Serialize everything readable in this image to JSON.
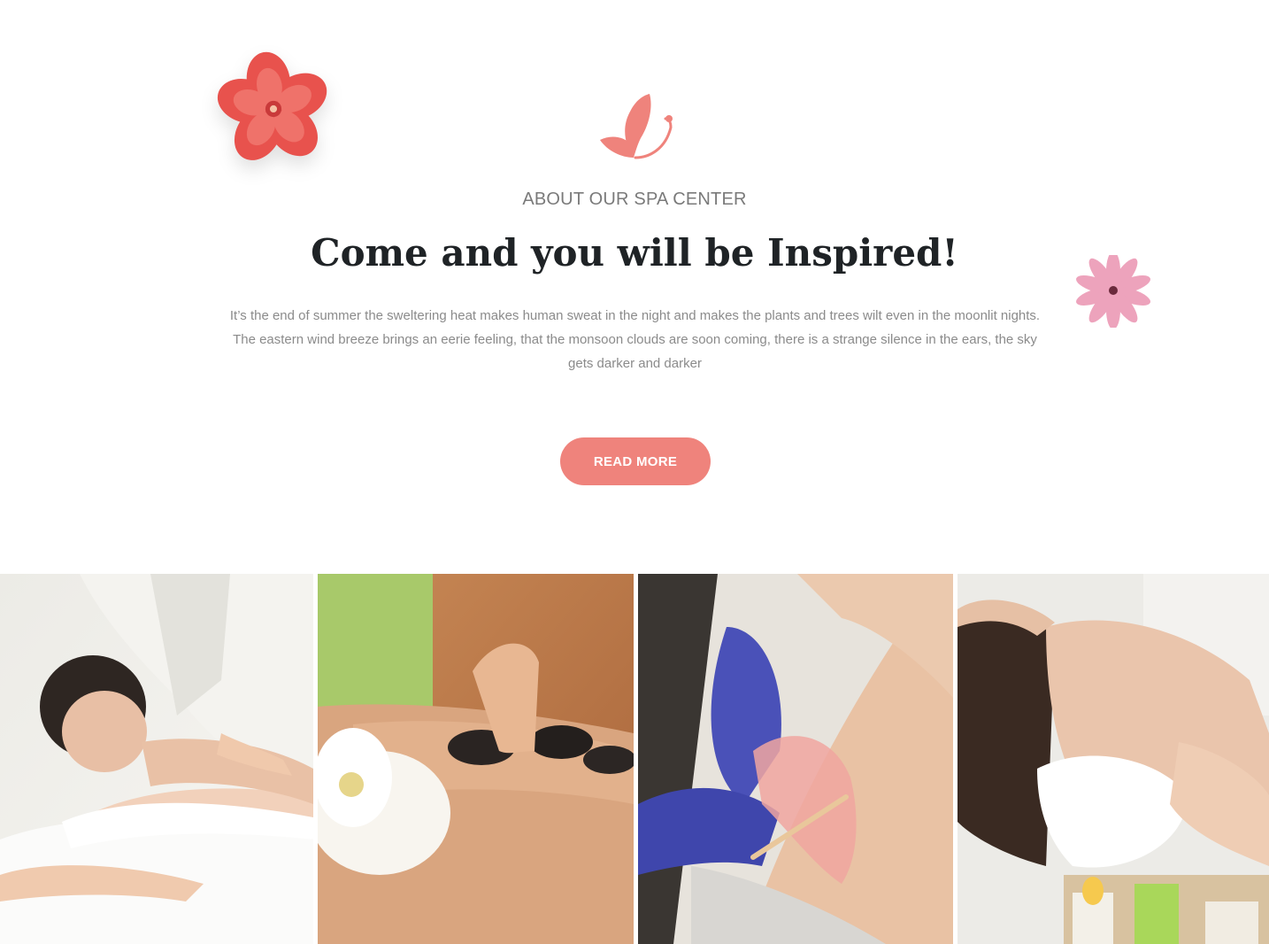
{
  "about": {
    "subtitle": "ABOUT OUR SPA CENTER",
    "title": "Come and you will be Inspired!",
    "body": "It’s the end of summer the sweltering heat makes human sweat in the night and makes the plants and trees wilt even in the moonlit nights. The eastern wind breeze brings an eerie feeling, that the monsoon clouds are soon coming, there is a strange silence in the ears, the sky gets darker and darker",
    "button_label": "READ MORE"
  },
  "colors": {
    "accent": "#ef837c",
    "title": "#1f2326",
    "text": "#8b8b8b"
  },
  "icons": {
    "decor_left": "red-hibiscus-flower-icon",
    "logo": "butterfly-icon",
    "decor_right": "pink-flower-icon"
  },
  "gallery": {
    "images": [
      "back-massage-photo",
      "hot-stone-massage-photo",
      "waxing-treatment-photo",
      "head-massage-photo"
    ]
  }
}
